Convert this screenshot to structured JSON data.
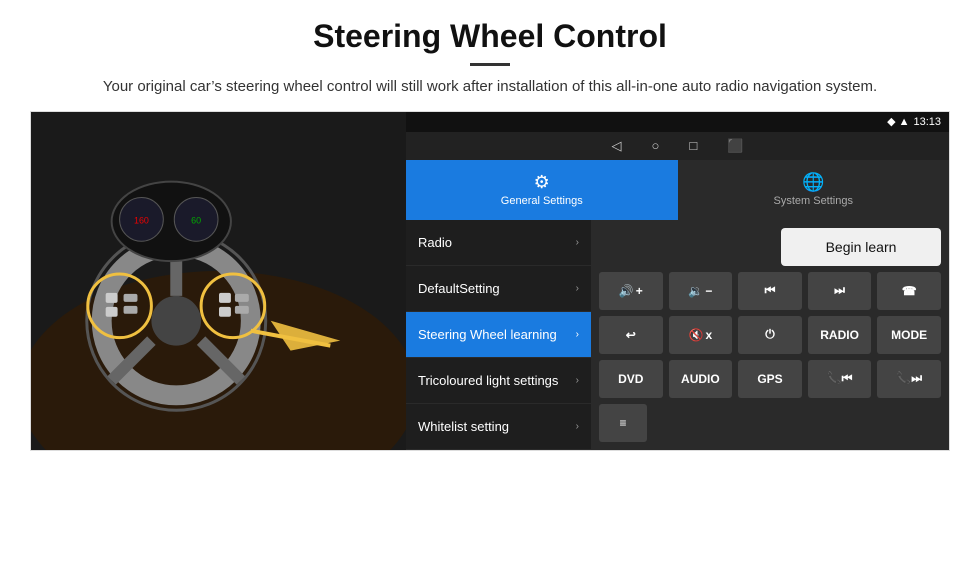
{
  "header": {
    "title": "Steering Wheel Control",
    "subtitle": "Your original car’s steering wheel control will still work after installation of this all-in-one auto radio navigation system."
  },
  "status_bar": {
    "time": "13:13",
    "icons": [
      "location",
      "wifi",
      "signal"
    ]
  },
  "nav_bar": {
    "icons": [
      "back",
      "home",
      "recent",
      "screenshot"
    ]
  },
  "tabs": [
    {
      "id": "general",
      "label": "General Settings",
      "active": true,
      "icon": "⚙"
    },
    {
      "id": "system",
      "label": "System Settings",
      "active": false,
      "icon": "🌐"
    }
  ],
  "menu": {
    "items": [
      {
        "id": "radio",
        "label": "Radio",
        "selected": false
      },
      {
        "id": "default-setting",
        "label": "DefaultSetting",
        "selected": false
      },
      {
        "id": "steering-wheel",
        "label": "Steering Wheel learning",
        "selected": true
      },
      {
        "id": "tricoloured",
        "label": "Tricoloured light settings",
        "selected": false
      },
      {
        "id": "whitelist",
        "label": "Whitelist setting",
        "selected": false
      }
    ]
  },
  "right_panel": {
    "begin_learn_label": "Begin learn",
    "rows": [
      [
        {
          "id": "vol-up",
          "label": "",
          "icon": "🔊+",
          "display": "▲+"
        },
        {
          "id": "vol-down",
          "label": "",
          "icon": "🔉−",
          "display": "◀−"
        },
        {
          "id": "prev-track",
          "label": "",
          "icon": "|◀◀",
          "display": "⏮"
        },
        {
          "id": "next-track",
          "label": "",
          "icon": "▶▶|",
          "display": "⏭"
        },
        {
          "id": "phone",
          "label": "",
          "icon": "📞",
          "display": "☎"
        }
      ],
      [
        {
          "id": "hang-up",
          "label": "",
          "icon": "↩",
          "display": "↩"
        },
        {
          "id": "mute",
          "label": "",
          "icon": "🔇",
          "display": "🔇"
        },
        {
          "id": "power",
          "label": "",
          "icon": "⏻",
          "display": "⏻"
        },
        {
          "id": "radio-btn",
          "label": "RADIO",
          "icon": "",
          "display": "RADIO"
        },
        {
          "id": "mode-btn",
          "label": "MODE",
          "icon": "",
          "display": "MODE"
        }
      ],
      [
        {
          "id": "dvd-btn",
          "label": "DVD",
          "icon": "",
          "display": "DVD"
        },
        {
          "id": "audio-btn",
          "label": "AUDIO",
          "icon": "",
          "display": "AUDIO"
        },
        {
          "id": "gps-btn",
          "label": "GPS",
          "icon": "",
          "display": "GPS"
        },
        {
          "id": "phone-prev",
          "label": "",
          "icon": "📞⏮",
          "display": "📞⏮"
        },
        {
          "id": "phone-next",
          "label": "",
          "icon": "📞⏭",
          "display": "📞⏭"
        }
      ]
    ],
    "bottom_row": {
      "icon_btn": "≡"
    }
  }
}
